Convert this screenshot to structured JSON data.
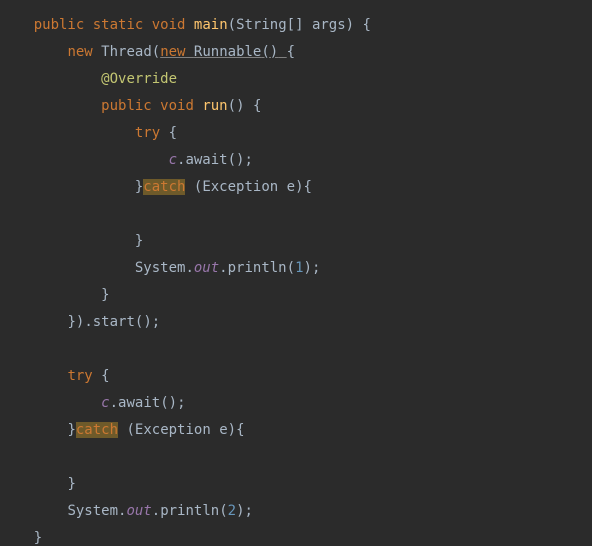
{
  "code": {
    "kw_public": "public",
    "kw_static": "static",
    "kw_void": "void",
    "kw_new": "new",
    "kw_try": "try",
    "kw_catch": "catch",
    "ann_override": "@Override",
    "type_string_arr": "String[]",
    "type_thread": "Thread",
    "type_runnable": "Runnable",
    "type_exception": "Exception",
    "type_system": "System",
    "id_args": "args",
    "id_e": "e",
    "field_c": "c",
    "field_out": "out",
    "m_main": "main",
    "m_run": "run",
    "m_await": "await",
    "m_start": "start",
    "m_println": "println",
    "lit_1": "1",
    "lit_2": "2",
    "sp": " ",
    "lparen": "(",
    "rparen": ")",
    "lbrace": "{",
    "rbrace": "}",
    "dot": ".",
    "comma": ",",
    "semi": ";",
    "indent1": "    ",
    "indent2": "        ",
    "indent3": "            ",
    "indent4": "                ",
    "indent5": "                    "
  }
}
